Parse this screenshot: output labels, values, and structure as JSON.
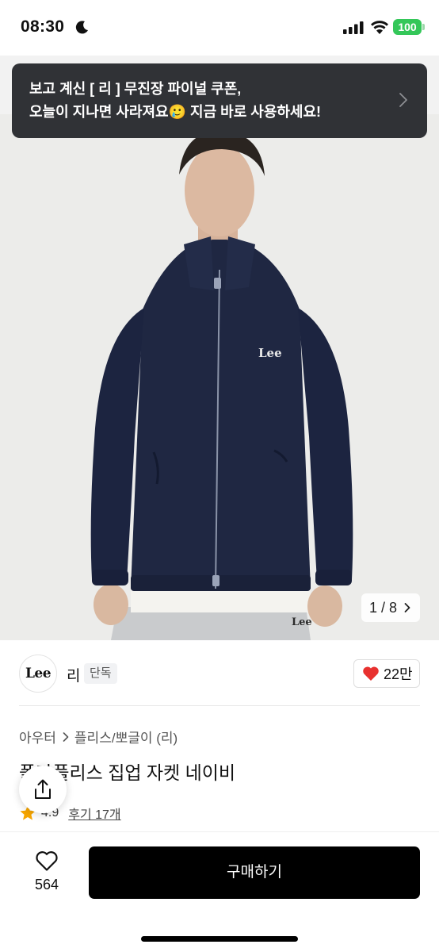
{
  "status_bar": {
    "time": "08:30",
    "battery": "100",
    "icons": [
      "moon-icon",
      "signal-icon",
      "wifi-icon",
      "battery-icon"
    ],
    "battery_color": "#34c759"
  },
  "toast": {
    "line1": "보고 계신 [ 리 ] 무진장 파이널 쿠폰,",
    "line2": "오늘이 지나면 사라져요🥲 지금 바로 사용하세요!",
    "background": "#303236"
  },
  "gallery": {
    "counter": "1 / 8",
    "chest_logo": "Lee",
    "pants_logo": "Lee"
  },
  "brand": {
    "logo_text": "Lee",
    "name": "리",
    "badge": "단독",
    "likes": "22만"
  },
  "product": {
    "breadcrumb": [
      "아우터",
      "플리스/뽀글이 (리)"
    ],
    "title": "폴라플리스 집업 자켓 네이비",
    "rating": "4.9",
    "reviews": "후기 17개"
  },
  "bottom_bar": {
    "wish_count": "564",
    "buy_label": "구매하기"
  },
  "colors": {
    "heart": "#e8312f",
    "star": "#f7a600",
    "jacket": "#1d2540",
    "buy_button": "#000000"
  }
}
